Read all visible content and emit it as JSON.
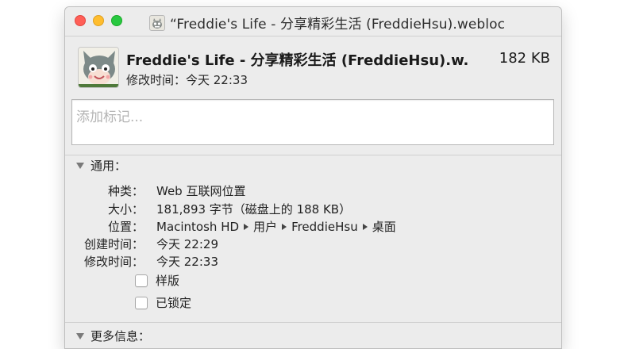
{
  "window": {
    "title": "“Freddie's Life - 分享精彩生活 (FreddieHsu).webloc"
  },
  "header": {
    "name": "Freddie's Life - 分享精彩生活 (FreddieHsu).w...",
    "size": "182 KB",
    "modified": "修改时间：今天 22:33"
  },
  "tags": {
    "placeholder": "添加标记..."
  },
  "general": {
    "label": "通用：",
    "kind_label": "种类：",
    "kind_value": "Web 互联网位置",
    "size_label": "大小：",
    "size_value": "181,893 字节（磁盘上的 188 KB）",
    "where_label": "位置：",
    "where_path": [
      "Macintosh HD",
      "用户",
      "FreddieHsu",
      "桌面"
    ],
    "created_label": "创建时间：",
    "created_value": "今天 22:29",
    "modified_label": "修改时间：",
    "modified_value": "今天 22:33",
    "stationery_label": "样版",
    "locked_label": "已锁定"
  },
  "more_info": {
    "label": "更多信息："
  },
  "icons": {
    "title_icon": "webloc-file-icon",
    "file_icon": "monster-avatar-icon"
  }
}
